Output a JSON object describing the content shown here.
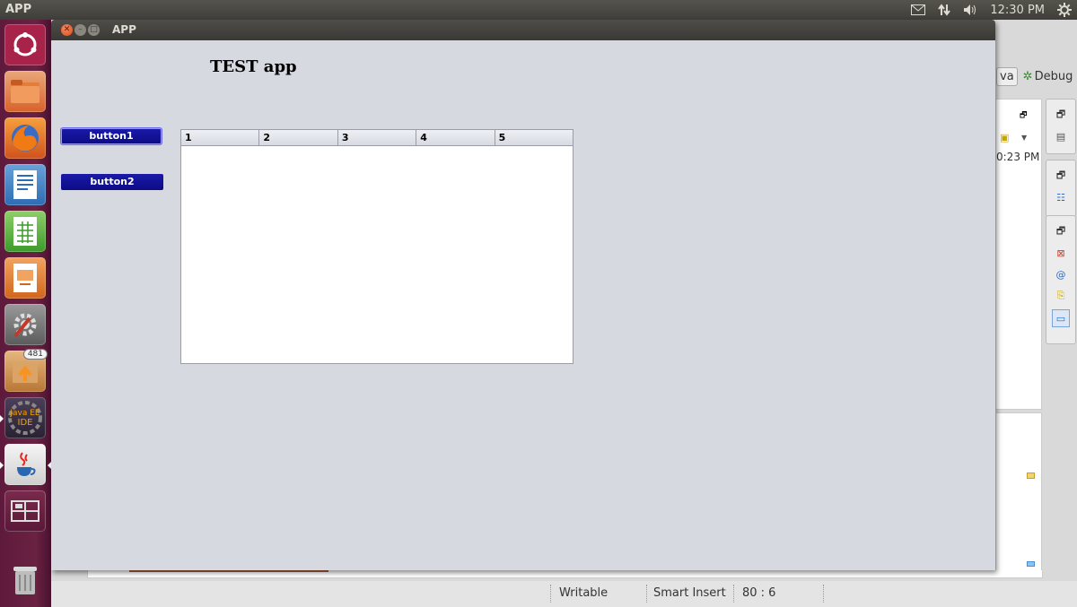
{
  "top_panel": {
    "app_name": "APP",
    "clock": "12:30 PM",
    "indicators": [
      "mail-icon",
      "network-icon",
      "volume-icon",
      "settings-gear-icon"
    ]
  },
  "launcher": {
    "items": [
      {
        "name": "ubuntu-dash-icon"
      },
      {
        "name": "files-icon"
      },
      {
        "name": "firefox-icon"
      },
      {
        "name": "libreoffice-writer-icon"
      },
      {
        "name": "libreoffice-calc-icon"
      },
      {
        "name": "libreoffice-impress-icon"
      },
      {
        "name": "system-settings-icon"
      },
      {
        "name": "software-updater-icon",
        "badge": "481"
      },
      {
        "name": "java-ee-ide-icon",
        "label": "Java EE IDE"
      },
      {
        "name": "java-app-icon"
      },
      {
        "name": "workspace-switcher-icon"
      },
      {
        "name": "trash-icon"
      }
    ]
  },
  "eclipse": {
    "perspective_java": "va",
    "perspective_debug": "Debug",
    "time_fragment": "0:23 PM"
  },
  "status_bar": {
    "writable": "Writable",
    "insert_mode": "Smart Insert",
    "position": "80 : 6"
  },
  "app_window": {
    "title": "APP",
    "heading": "TEST app",
    "button1_label": "button1",
    "button2_label": "button2",
    "table": {
      "columns": [
        "1",
        "2",
        "3",
        "4",
        "5"
      ],
      "rows": []
    }
  }
}
